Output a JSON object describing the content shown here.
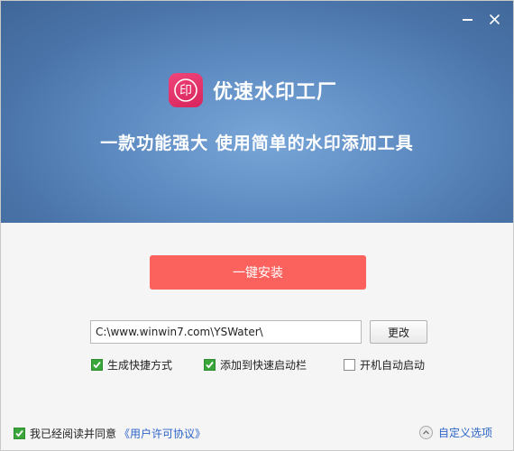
{
  "window": {
    "minimize_icon": "minimize-icon",
    "close_icon": "close-icon"
  },
  "brand": {
    "logo_glyph": "印",
    "app_name": "优速水印工厂",
    "slogan": "一款功能强大 使用简单的水印添加工具"
  },
  "install": {
    "button_label": "一键安装"
  },
  "path": {
    "value": "C:\\www.winwin7.com\\YSWater\\",
    "change_label": "更改"
  },
  "options": [
    {
      "label": "生成快捷方式",
      "checked": true
    },
    {
      "label": "添加到快速启动栏",
      "checked": true
    },
    {
      "label": "开机自动启动",
      "checked": false
    }
  ],
  "footer": {
    "agree_text": "我已经阅读并同意",
    "agree_checked": true,
    "license_link": "《用户许可协议》",
    "custom_label": "自定义选项"
  },
  "colors": {
    "header_bg": "#5e8cc2",
    "install_button": "#fb625d",
    "logo": "#e0336a",
    "checkbox_checked": "#3aa53a",
    "link": "#2b63c8"
  }
}
